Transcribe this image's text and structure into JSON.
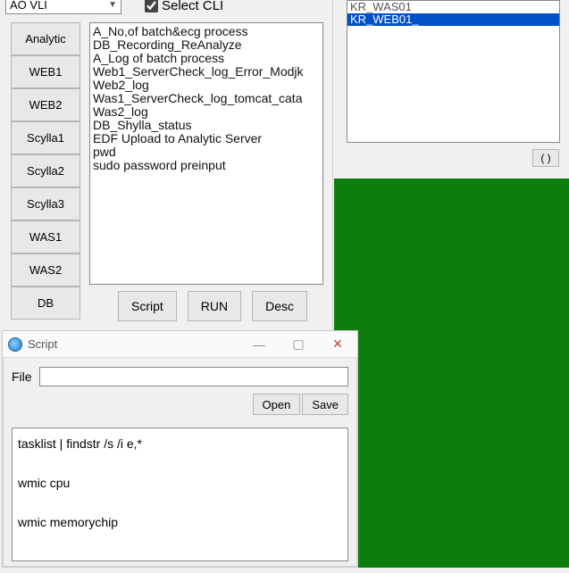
{
  "topDropdown": {
    "value": "AO VLI"
  },
  "selectCli": {
    "label": "Select CLI",
    "checked": true
  },
  "sideButtons": [
    "Analytic",
    "WEB1",
    "WEB2",
    "Scylla1",
    "Scylla2",
    "Scylla3",
    "WAS1",
    "WAS2",
    "DB"
  ],
  "listItems": [
    "A_No,of batch&ecg process",
    "DB_Recording_ReAnalyze",
    "A_Log of batch process",
    "Web1_ServerCheck_log_Error_Modjk",
    "Web2_log",
    "Was1_ServerCheck_log_tomcat_cata",
    "Was2_log",
    "DB_Shylla_status",
    "EDF Upload to Analytic Server",
    "pwd",
    "sudo password preinput"
  ],
  "actions": {
    "script": "Script",
    "run": "RUN",
    "desc": "Desc"
  },
  "rightList": {
    "partial": "KR_WAS01",
    "selected": "KR_WEB01_"
  },
  "parenBtn": "( )",
  "scriptWin": {
    "title": "Script",
    "fileLabel": "File",
    "fileValue": "",
    "open": "Open",
    "save": "Save",
    "content": "tasklist | findstr /s /i e,*\n\nwmic cpu\n\nwmic memorychip"
  }
}
